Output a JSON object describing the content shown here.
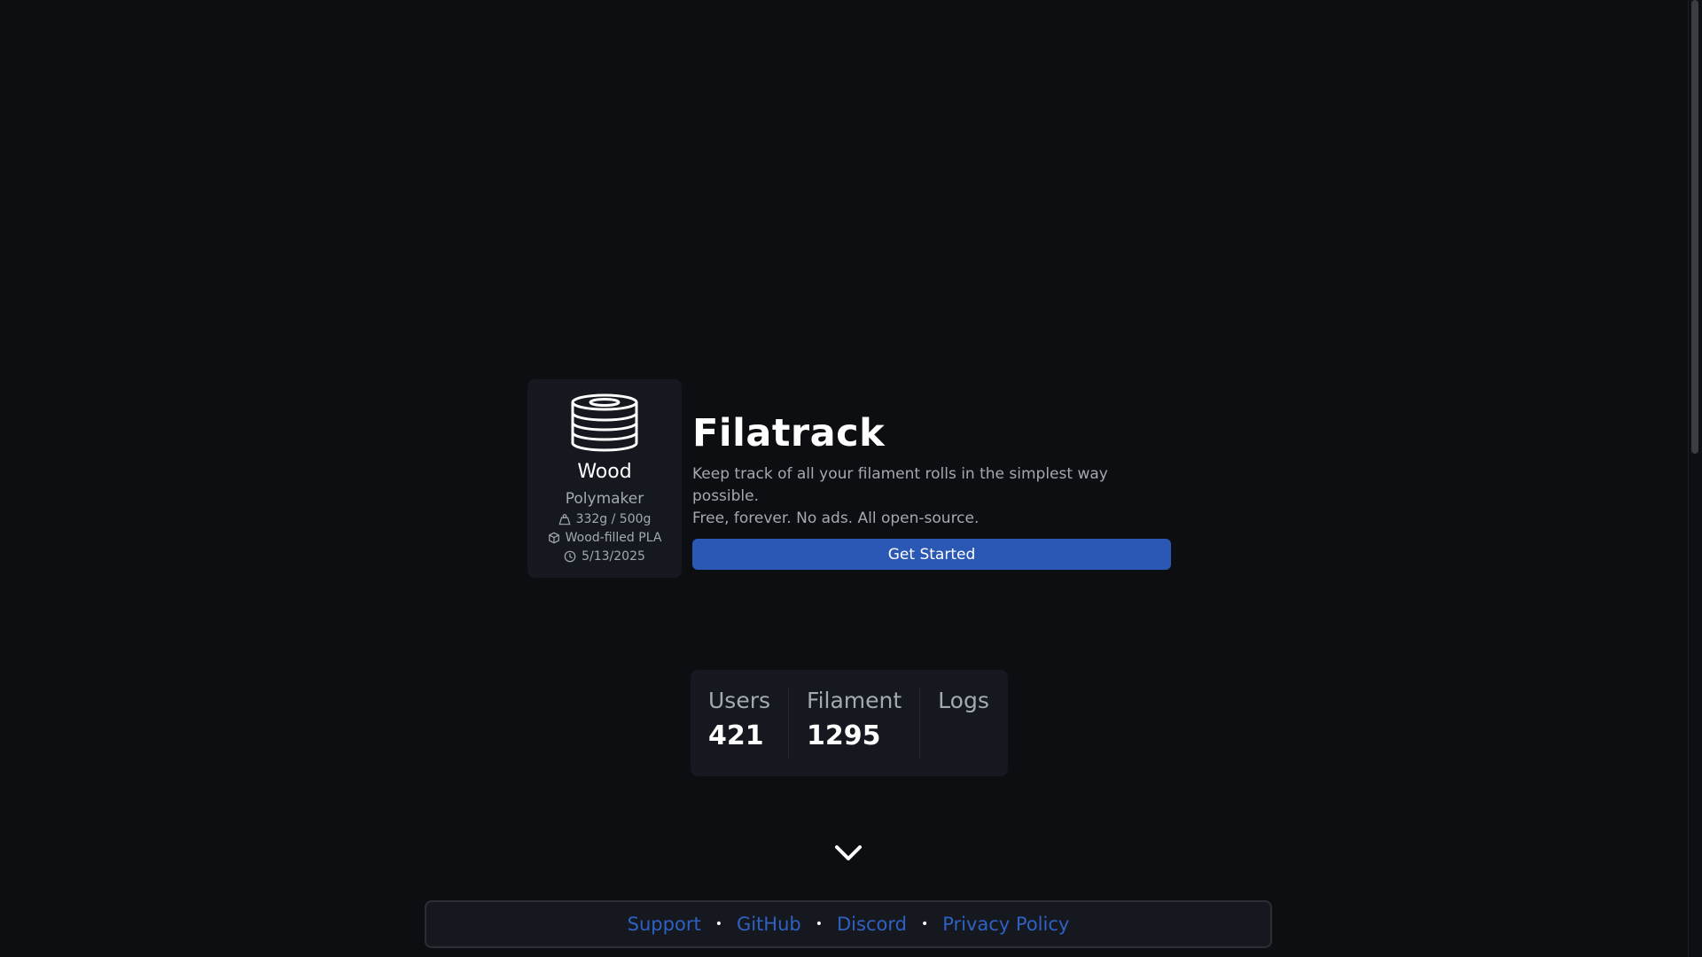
{
  "app": {
    "title": "Filatrack",
    "tagline_line1": "Keep track of all your filament rolls in the simplest way possible.",
    "tagline_line2": "Free, forever. No ads. All open-source.",
    "cta_label": "Get Started"
  },
  "card": {
    "icon": "spool-icon",
    "name": "Wood",
    "brand": "Polymaker",
    "weight": "332g / 500g",
    "material": "Wood-filled PLA",
    "date": "5/13/2025"
  },
  "stats": [
    {
      "label": "Users",
      "value": "421"
    },
    {
      "label": "Filament",
      "value": "1295"
    },
    {
      "label": "Logs",
      "value": ""
    }
  ],
  "footer": {
    "links": [
      "Support",
      "GitHub",
      "Discord",
      "Privacy Policy"
    ],
    "separator": "•"
  },
  "colors": {
    "background": "#0c0e12",
    "card": "#15181e",
    "accent": "#2b57b5",
    "link": "#2f61c4",
    "muted": "#a4a8b0"
  }
}
